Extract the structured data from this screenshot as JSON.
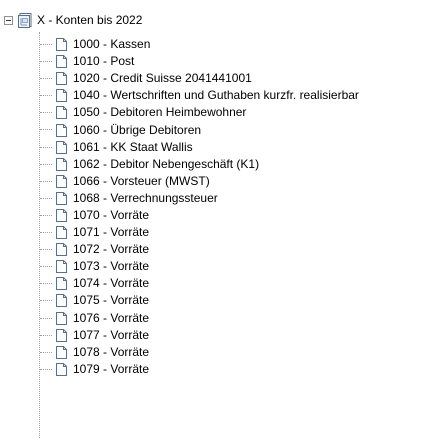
{
  "tree": {
    "root": {
      "label": "X - Konten bis 2022",
      "expanded": true,
      "icon": "database-folder-icon"
    },
    "items": [
      {
        "label": "1000 - Kassen",
        "icon": "document-icon"
      },
      {
        "label": "1010 - Post",
        "icon": "document-icon"
      },
      {
        "label": "1020 - Credit Suisse 2041441001",
        "icon": "document-icon"
      },
      {
        "label": "1040 - Wertschriften und Guthaben kurzfr. realisierbar",
        "icon": "document-icon"
      },
      {
        "label": "1050 - Debitoren Heimbewohner",
        "icon": "document-icon"
      },
      {
        "label": "1060 - Übrige Debitoren",
        "icon": "document-icon"
      },
      {
        "label": "1061 - KK Staat Wallis",
        "icon": "document-icon"
      },
      {
        "label": "1062 - Debitor Nebengeschäft (K1)",
        "icon": "document-icon"
      },
      {
        "label": "1066 - Vorsteuer (MWST)",
        "icon": "document-icon"
      },
      {
        "label": "1068 - Verrechnungssteuer",
        "icon": "document-icon"
      },
      {
        "label": "1070 - Vorräte",
        "icon": "document-icon"
      },
      {
        "label": "1071 - Vorräte",
        "icon": "document-icon"
      },
      {
        "label": "1072 - Vorräte",
        "icon": "document-icon"
      },
      {
        "label": "1073 - Vorräte",
        "icon": "document-icon"
      },
      {
        "label": "1074 - Vorräte",
        "icon": "document-icon"
      },
      {
        "label": "1075 - Vorräte",
        "icon": "document-icon"
      },
      {
        "label": "1076 - Vorräte",
        "icon": "document-icon"
      },
      {
        "label": "1077 - Vorräte",
        "icon": "document-icon"
      },
      {
        "label": "1078 - Vorräte",
        "icon": "document-icon"
      },
      {
        "label": "1079 - Vorräte",
        "icon": "document-icon"
      }
    ]
  },
  "colors": {
    "background": "#ffffff",
    "text": "#000000",
    "connector": "#a0a0a0",
    "icon_outline": "#5a6f8c"
  }
}
